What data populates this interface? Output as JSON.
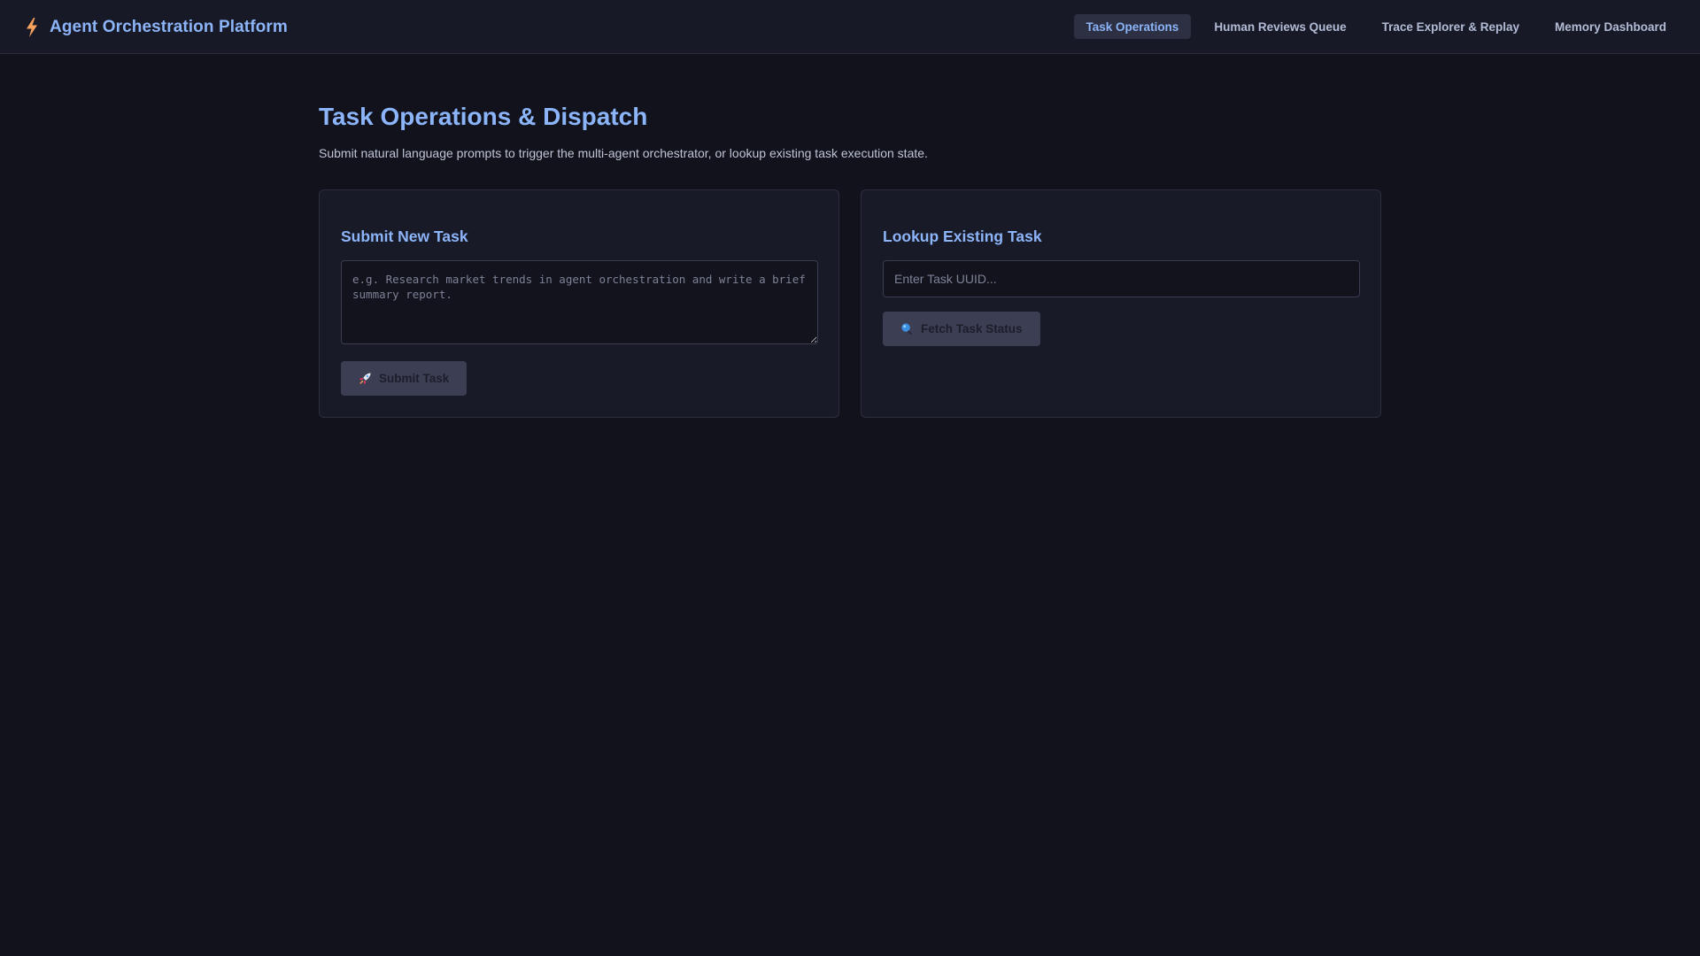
{
  "app": {
    "title": "Agent Orchestration Platform",
    "icon": "lightning-bolt-icon",
    "accent_color": "#8cb4f8",
    "icon_color": "#f5a35c"
  },
  "nav": {
    "items": [
      {
        "label": "Task Operations",
        "active": true
      },
      {
        "label": "Human Reviews Queue",
        "active": false
      },
      {
        "label": "Trace Explorer & Replay",
        "active": false
      },
      {
        "label": "Memory Dashboard",
        "active": false
      }
    ]
  },
  "page": {
    "title": "Task Operations & Dispatch",
    "description": "Submit natural language prompts to trigger the multi-agent orchestrator, or lookup existing task execution state."
  },
  "submit_card": {
    "title": "Submit New Task",
    "textarea_value": "",
    "textarea_placeholder": "e.g. Research market trends in agent orchestration and write a brief summary report.",
    "button_label": "Submit Task",
    "button_icon": "rocket-icon"
  },
  "lookup_card": {
    "title": "Lookup Existing Task",
    "input_value": "",
    "input_placeholder": "Enter Task UUID...",
    "button_label": "Fetch Task Status",
    "button_icon": "magnifier-icon"
  }
}
